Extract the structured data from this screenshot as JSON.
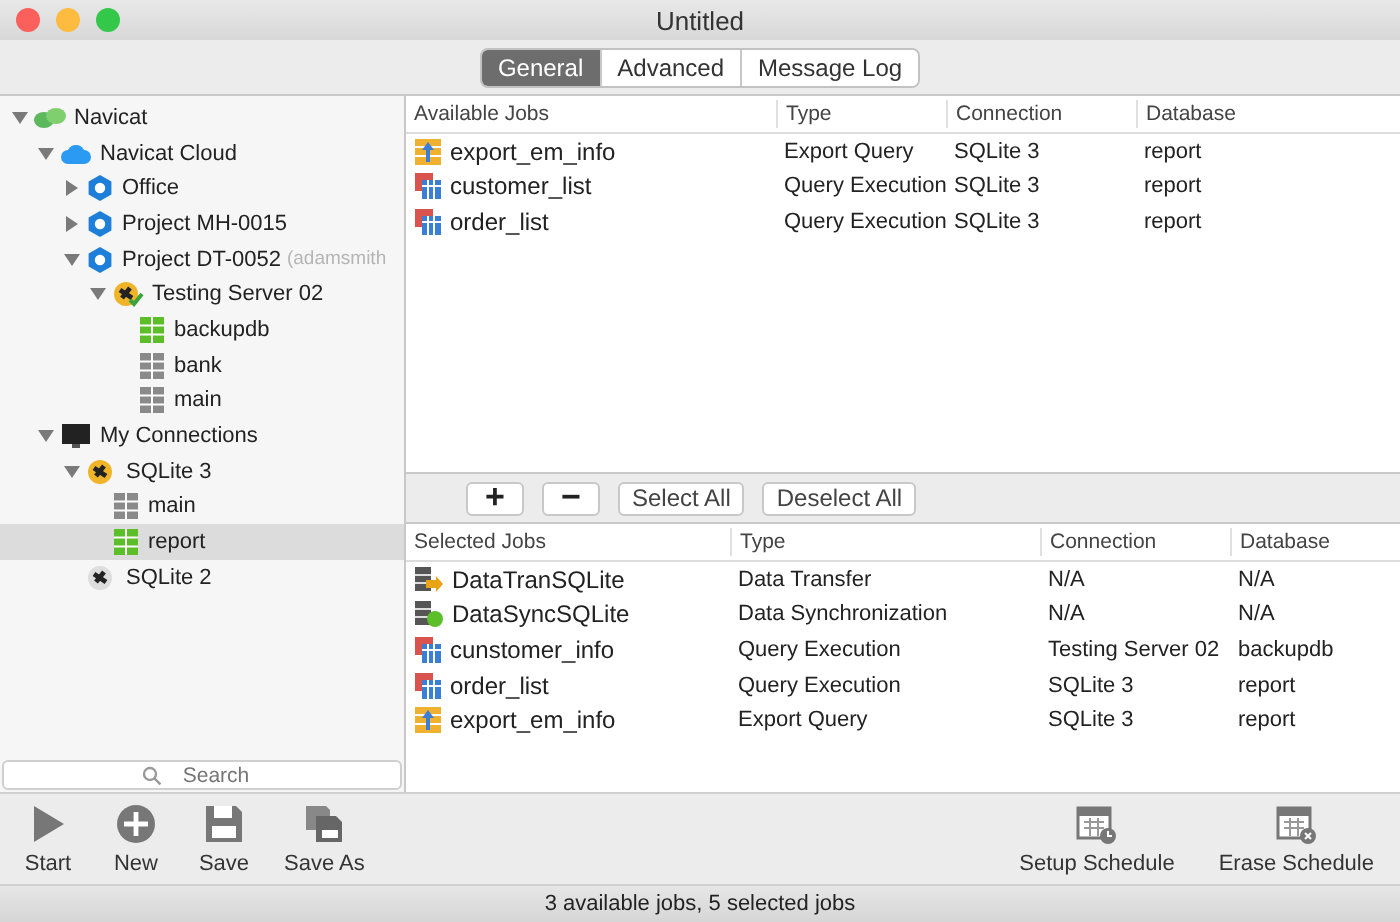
{
  "window": {
    "title": "Untitled"
  },
  "tabs": [
    {
      "label": "General",
      "selected": true
    },
    {
      "label": "Advanced",
      "selected": false
    },
    {
      "label": "Message Log",
      "selected": false
    }
  ],
  "sidebar": {
    "tree": [
      {
        "label": "Navicat",
        "kind": "navicat",
        "expanded": true,
        "selected": false,
        "children": [
          {
            "label": "Navicat Cloud",
            "kind": "cloud",
            "expanded": true,
            "selected": false,
            "children": [
              {
                "label": "Office",
                "kind": "project",
                "expanded": false,
                "selected": false
              },
              {
                "label": "Project MH-0015",
                "kind": "project",
                "expanded": false,
                "selected": false
              },
              {
                "label": "Project DT-0052",
                "note": "(adamsmith",
                "kind": "project",
                "expanded": true,
                "selected": false,
                "children": [
                  {
                    "label": "Testing Server 02",
                    "kind": "server",
                    "expanded": true,
                    "selected": false,
                    "children": [
                      {
                        "label": "backupdb",
                        "kind": "db-open",
                        "selected": false
                      },
                      {
                        "label": "bank",
                        "kind": "db",
                        "selected": false
                      },
                      {
                        "label": "main",
                        "kind": "db",
                        "selected": false
                      }
                    ]
                  }
                ]
              }
            ]
          },
          {
            "label": "My Connections",
            "kind": "monitor",
            "expanded": true,
            "selected": false,
            "children": [
              {
                "label": "SQLite 3",
                "kind": "sqlite",
                "expanded": true,
                "selected": false,
                "children": [
                  {
                    "label": "main",
                    "kind": "db",
                    "selected": false
                  },
                  {
                    "label": "report",
                    "kind": "db-open",
                    "selected": true
                  }
                ]
              },
              {
                "label": "SQLite 2",
                "kind": "sqlite-off",
                "selected": false
              }
            ]
          }
        ]
      }
    ],
    "search": {
      "placeholder": "Search"
    }
  },
  "available_jobs": {
    "columns": [
      "Available Jobs",
      "Type",
      "Connection",
      "Database"
    ],
    "rows": [
      {
        "kind": "export",
        "name": "export_em_info",
        "type": "Export Query",
        "connection": "SQLite 3",
        "database": "report"
      },
      {
        "kind": "query",
        "name": "customer_list",
        "type": "Query Execution",
        "connection": "SQLite 3",
        "database": "report"
      },
      {
        "kind": "query",
        "name": "order_list",
        "type": "Query Execution",
        "connection": "SQLite 3",
        "database": "report"
      }
    ]
  },
  "job_buttons": [
    {
      "kind": "add",
      "label": "+"
    },
    {
      "kind": "remove",
      "label": "−"
    },
    {
      "kind": "text",
      "label": "Select All"
    },
    {
      "kind": "text",
      "label": "Deselect All"
    }
  ],
  "selected_jobs": {
    "columns": [
      "Selected Jobs",
      "Type",
      "Connection",
      "Database"
    ],
    "rows": [
      {
        "kind": "transfer",
        "name": "DataTranSQLite",
        "type": "Data Transfer",
        "connection": "N/A",
        "database": "N/A"
      },
      {
        "kind": "sync",
        "name": "DataSyncSQLite",
        "type": "Data Synchronization",
        "connection": "N/A",
        "database": "N/A"
      },
      {
        "kind": "query",
        "name": "cunstomer_info",
        "type": "Query Execution",
        "connection": "Testing Server 02",
        "database": "backupdb"
      },
      {
        "kind": "query",
        "name": "order_list",
        "type": "Query Execution",
        "connection": "SQLite 3",
        "database": "report"
      },
      {
        "kind": "export",
        "name": "export_em_info",
        "type": "Export Query",
        "connection": "SQLite 3",
        "database": "report"
      }
    ]
  },
  "toolbar": {
    "left": [
      {
        "kind": "start",
        "label": "Start"
      },
      {
        "kind": "new",
        "label": "New"
      },
      {
        "kind": "save",
        "label": "Save"
      },
      {
        "kind": "save-as",
        "label": "Save As"
      }
    ],
    "right": [
      {
        "kind": "schedule",
        "label": "Setup Schedule"
      },
      {
        "kind": "erase",
        "label": "Erase Schedule"
      }
    ]
  },
  "status_bar": "3 available jobs, 5 selected jobs"
}
